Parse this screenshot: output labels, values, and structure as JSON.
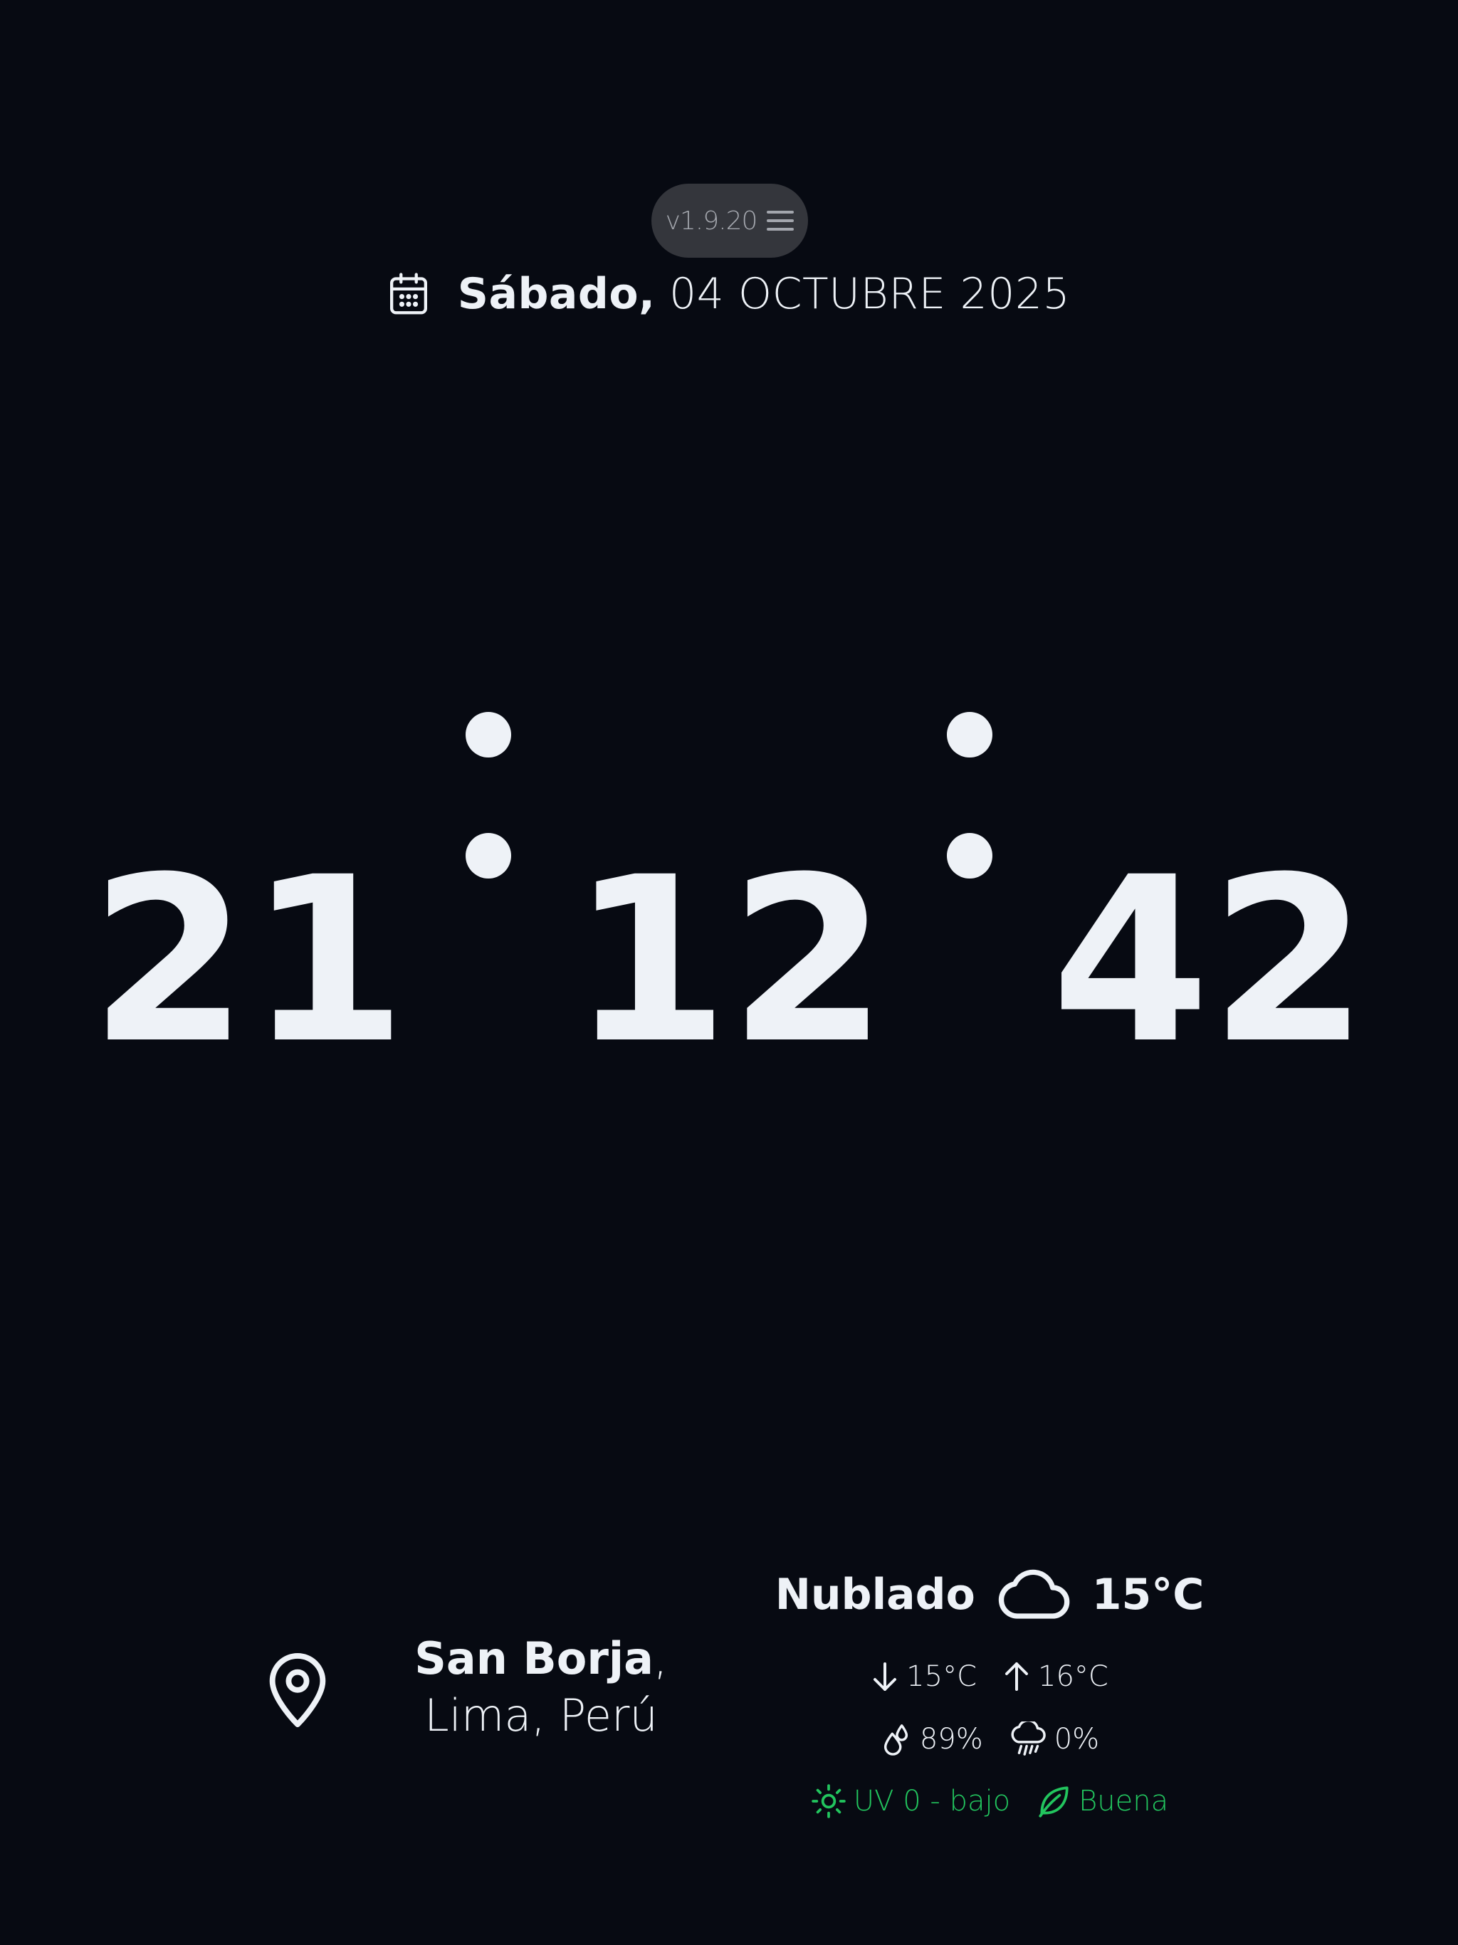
{
  "header": {
    "version": "v1.9.20"
  },
  "date": {
    "weekday": "Sábado,",
    "rest": " 04 OCTUBRE 2025"
  },
  "clock": {
    "hours": "21",
    "minutes": "12",
    "seconds": "42"
  },
  "location": {
    "city": "San Borja",
    "region": ", Lima, Perú"
  },
  "weather": {
    "condition": "Nublado",
    "condition_icon": "cloud-icon",
    "temperature": "15°C",
    "min_temp": "15°C",
    "max_temp": "16°C",
    "humidity": "89%",
    "rain_chance": "0%",
    "uv": "UV 0 - bajo",
    "air_quality": "Buena"
  },
  "colors": {
    "background": "#070a12",
    "text": "#eef2f7",
    "pill": "#34363c",
    "accent_green": "#22c55e"
  }
}
